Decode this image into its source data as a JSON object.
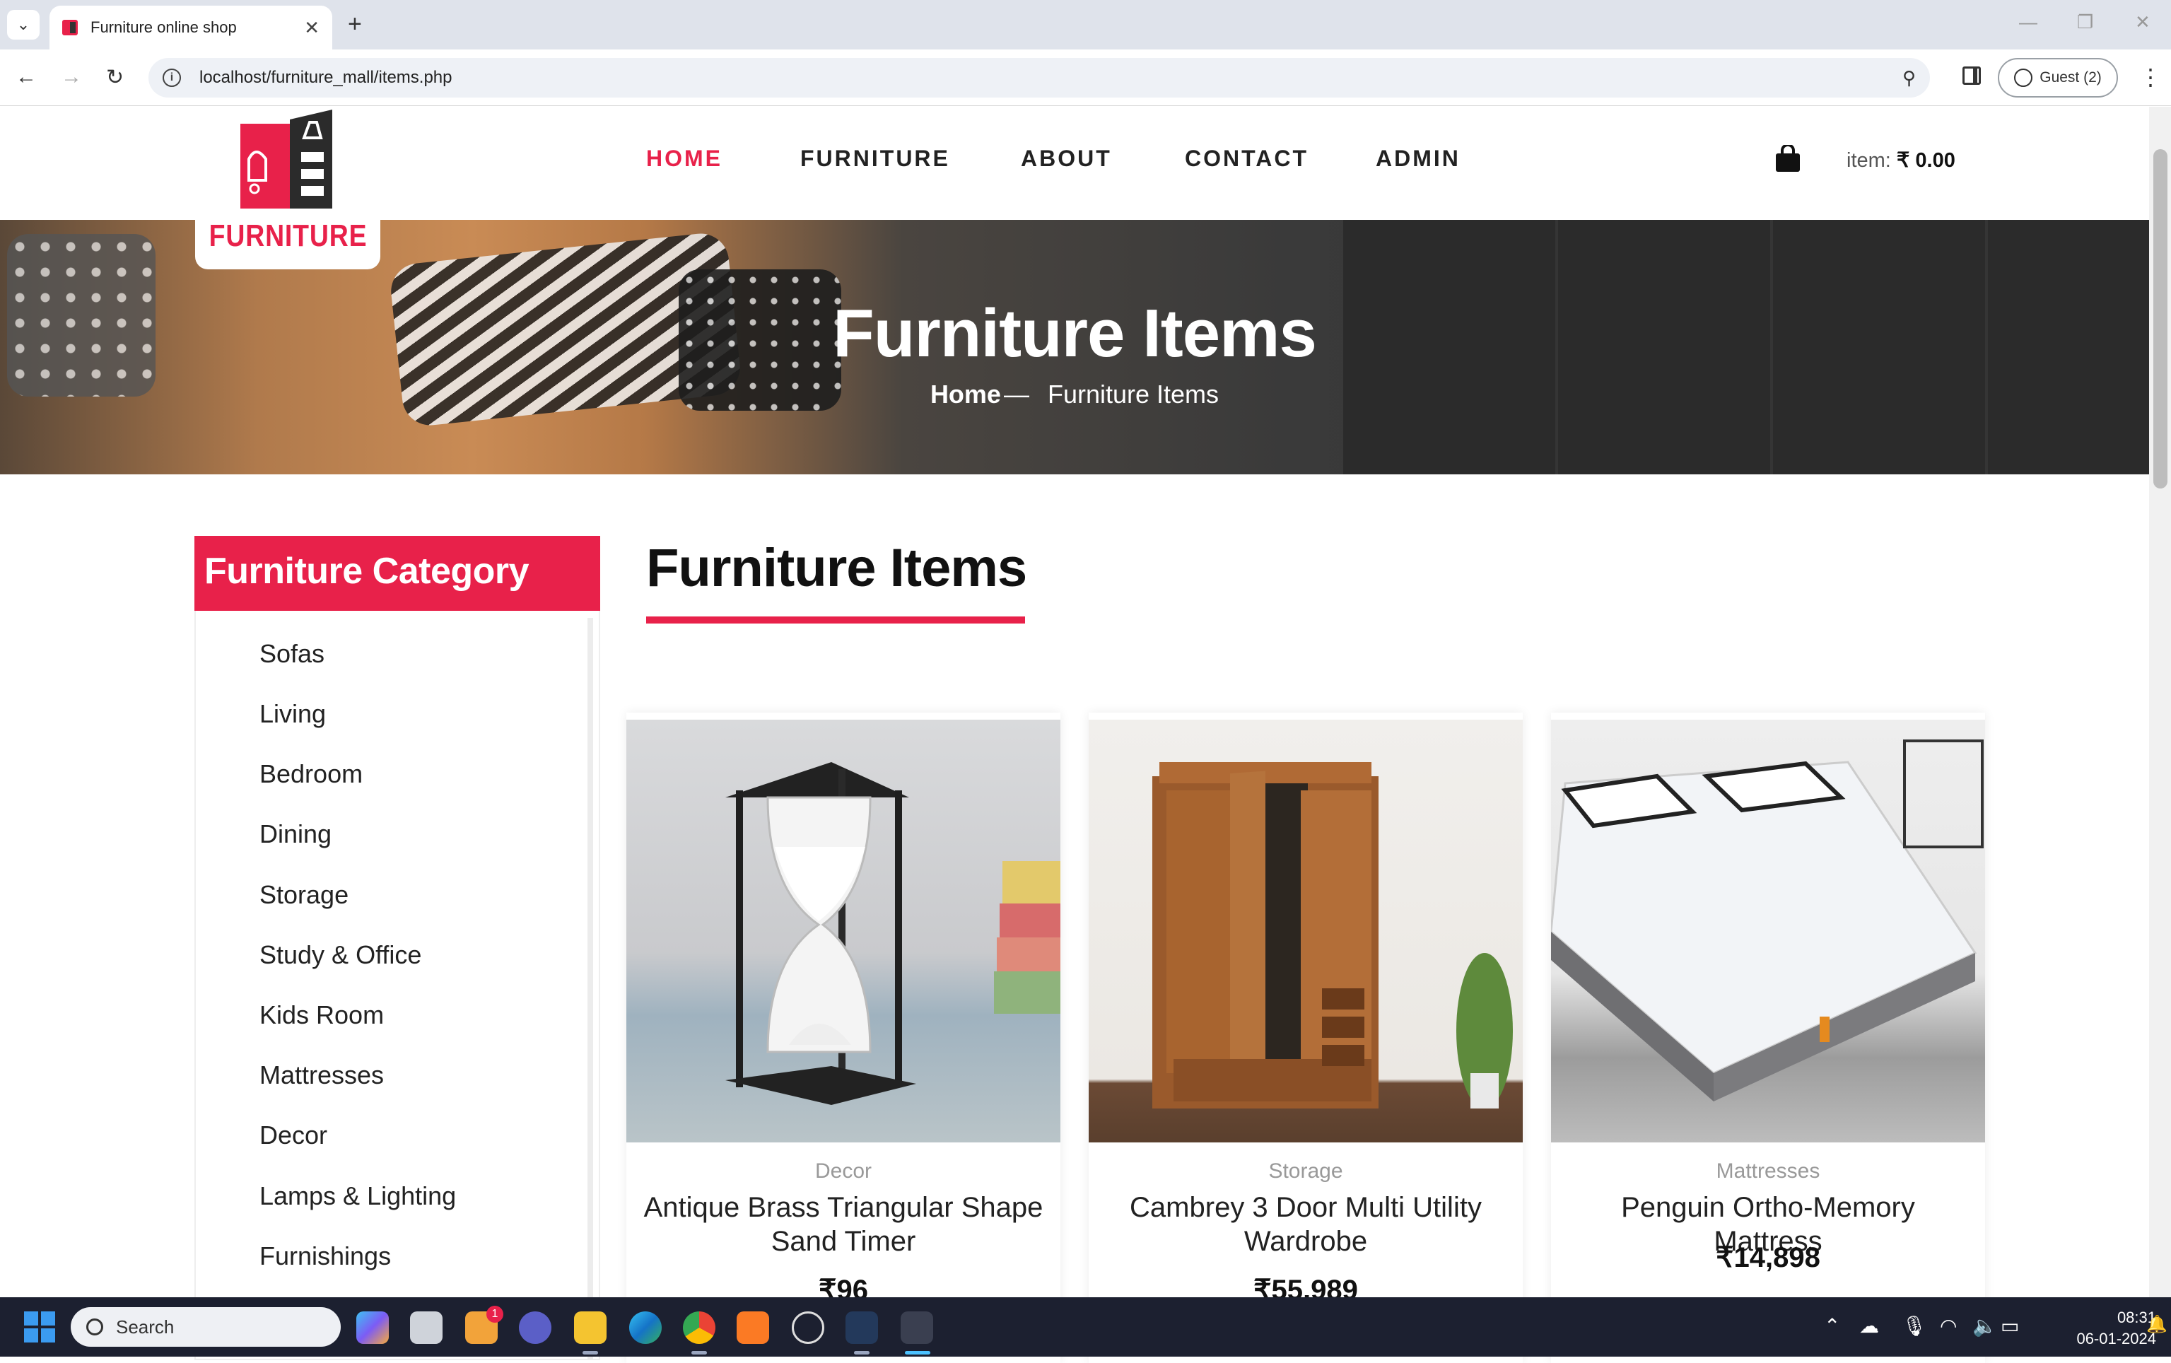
{
  "browser": {
    "tab_title": "Furniture online shop",
    "url": "localhost/furniture_mall/items.php",
    "profile_label": "Guest (2)"
  },
  "site": {
    "logo_text": "FURNITURE",
    "nav": [
      {
        "label": "HOME",
        "active": true
      },
      {
        "label": "FURNITURE",
        "active": false
      },
      {
        "label": "ABOUT",
        "active": false
      },
      {
        "label": "CONTACT",
        "active": false
      },
      {
        "label": "ADMIN",
        "active": false
      }
    ],
    "cart_label": "item:",
    "cart_total": "₹ 0.00"
  },
  "hero": {
    "title": "Furniture Items",
    "breadcrumb_home": "Home",
    "breadcrumb_sep": "—",
    "breadcrumb_current": "Furniture Items"
  },
  "sidebar": {
    "heading": "Furniture Category",
    "items": [
      "Sofas",
      "Living",
      "Bedroom",
      "Dining",
      "Storage",
      "Study & Office",
      "Kids Room",
      "Mattresses",
      "Decor",
      "Lamps & Lighting",
      "Furnishings"
    ]
  },
  "main": {
    "section_title": "Furniture Items",
    "products": [
      {
        "category": "Decor",
        "title": "Antique Brass Triangular Shape Sand Timer",
        "price": "₹96",
        "image_icon": "hourglass-image"
      },
      {
        "category": "Storage",
        "title": "Cambrey 3 Door Multi Utility Wardrobe",
        "price": "₹55,989",
        "image_icon": "wardrobe-image"
      },
      {
        "category": "Mattresses",
        "title": "Penguin Ortho-Memory Mattress",
        "price": "₹14,898",
        "image_icon": "mattress-image"
      }
    ]
  },
  "taskbar": {
    "search_placeholder": "Search",
    "time": "08:31",
    "date": "06-01-2024",
    "notification_badge": "1"
  },
  "colors": {
    "accent": "#e8214a",
    "taskbar": "#1c2030"
  }
}
